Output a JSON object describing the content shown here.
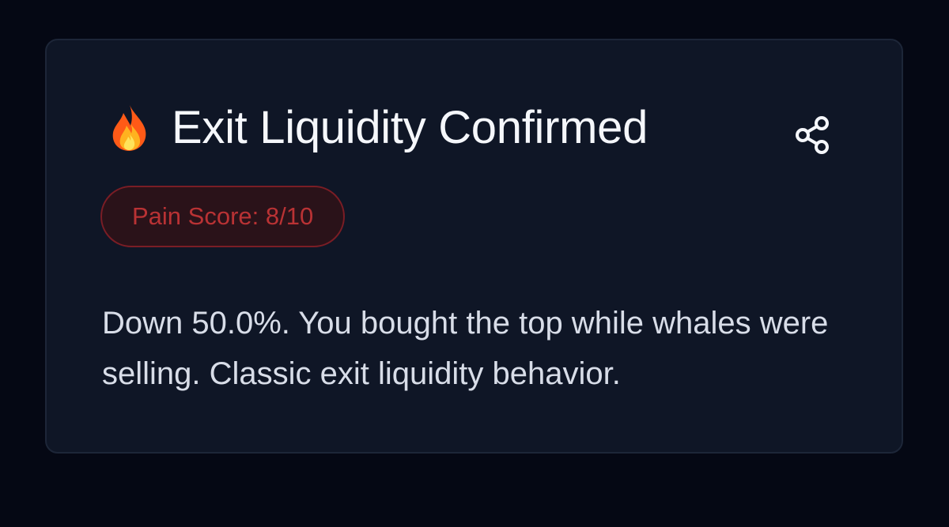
{
  "card": {
    "title": "Exit Liquidity Confirmed",
    "title_icon": "fire-icon",
    "share_icon": "share-icon",
    "badge": "Pain Score: 8/10",
    "description": "Down 50.0%. You bought the top while whales were selling. Classic exit liquidity behavior."
  },
  "colors": {
    "background": "#050814",
    "card_background": "#0f1626",
    "card_border": "#1d2638",
    "title_text": "#f5f7fb",
    "badge_text": "#b93234",
    "badge_border": "#7a1d25",
    "badge_background": "#2a1219",
    "description_text": "#d8dde8"
  }
}
